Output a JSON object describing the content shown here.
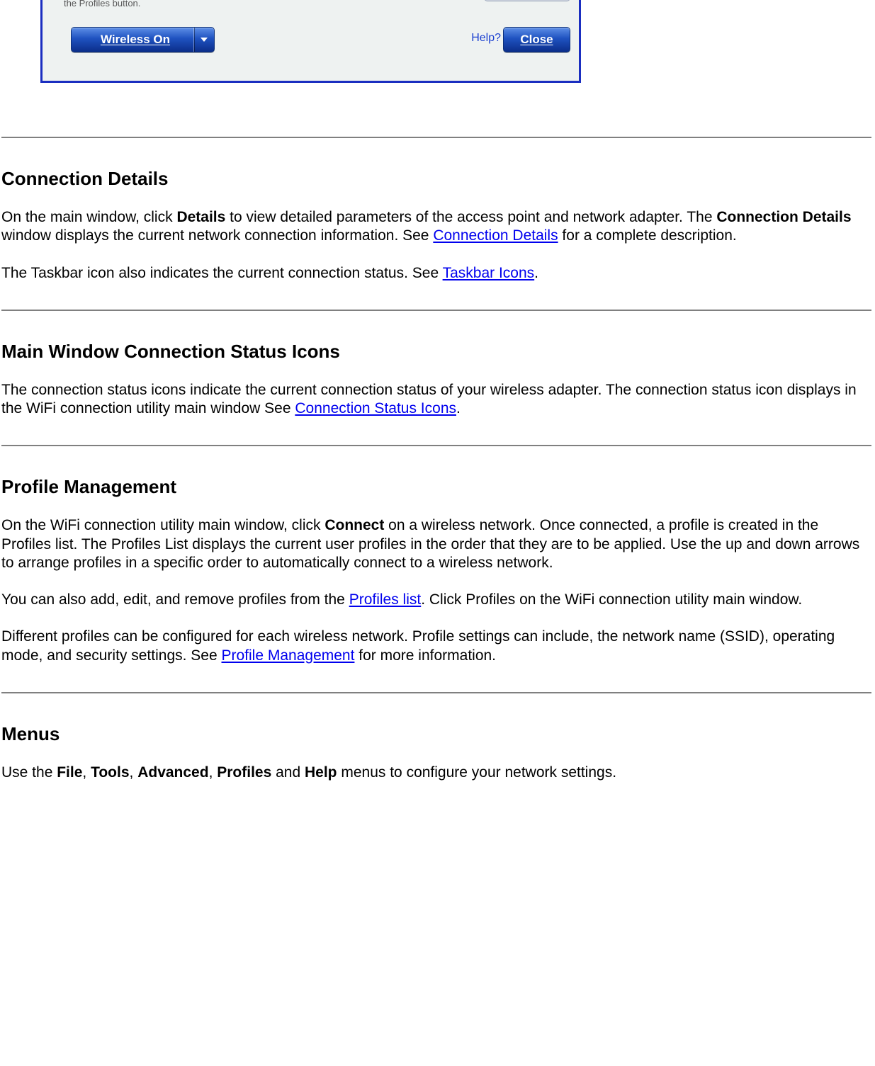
{
  "dialog": {
    "hint": "the Profiles button.",
    "wireless_button": "Wireless On",
    "help_label": "Help?",
    "close_button": "Close"
  },
  "sections": {
    "connection_details": {
      "heading": "Connection Details",
      "p1_a": "On the main window, click ",
      "p1_b": "Details",
      "p1_c": " to view detailed parameters of the access point and network adapter. The ",
      "p1_d": "Connection Details",
      "p1_e": " window displays the current network connection information. See ",
      "p1_link": "Connection Details",
      "p1_f": " for a complete description.",
      "p2_a": "The Taskbar icon also indicates the current connection status. See ",
      "p2_link": "Taskbar Icons",
      "p2_b": "."
    },
    "status_icons": {
      "heading": "Main Window Connection Status Icons",
      "p1_a": "The connection status icons indicate the current connection status of your wireless adapter. The connection status icon displays in the WiFi connection utility main window See ",
      "p1_link": "Connection Status Icons",
      "p1_b": "."
    },
    "profile_mgmt": {
      "heading": "Profile Management",
      "p1_a": "On the WiFi connection utility main window, click ",
      "p1_b": "Connect",
      "p1_c": " on a wireless network. Once connected, a profile is created in the Profiles list. The Profiles List displays the current user profiles in the order that they are to be applied. Use the up and down arrows to arrange profiles in a specific order to automatically connect to a wireless network.",
      "p2_a": "You can also add, edit, and remove profiles from the ",
      "p2_link": "Profiles list",
      "p2_b": ". Click Profiles on the WiFi connection utility main window.",
      "p3_a": "Different profiles can be configured for each wireless network. Profile settings can include, the network name (SSID), operating mode, and security settings. See ",
      "p3_link": "Profile Management",
      "p3_b": " for more information."
    },
    "menus": {
      "heading": "Menus",
      "p1_a": "Use the ",
      "p1_b": "File",
      "p1_c": ", ",
      "p1_d": "Tools",
      "p1_e": ", ",
      "p1_f": "Advanced",
      "p1_g": ", ",
      "p1_h": "Profiles",
      "p1_i": " and ",
      "p1_j": "Help",
      "p1_k": " menus to configure your network settings."
    }
  }
}
